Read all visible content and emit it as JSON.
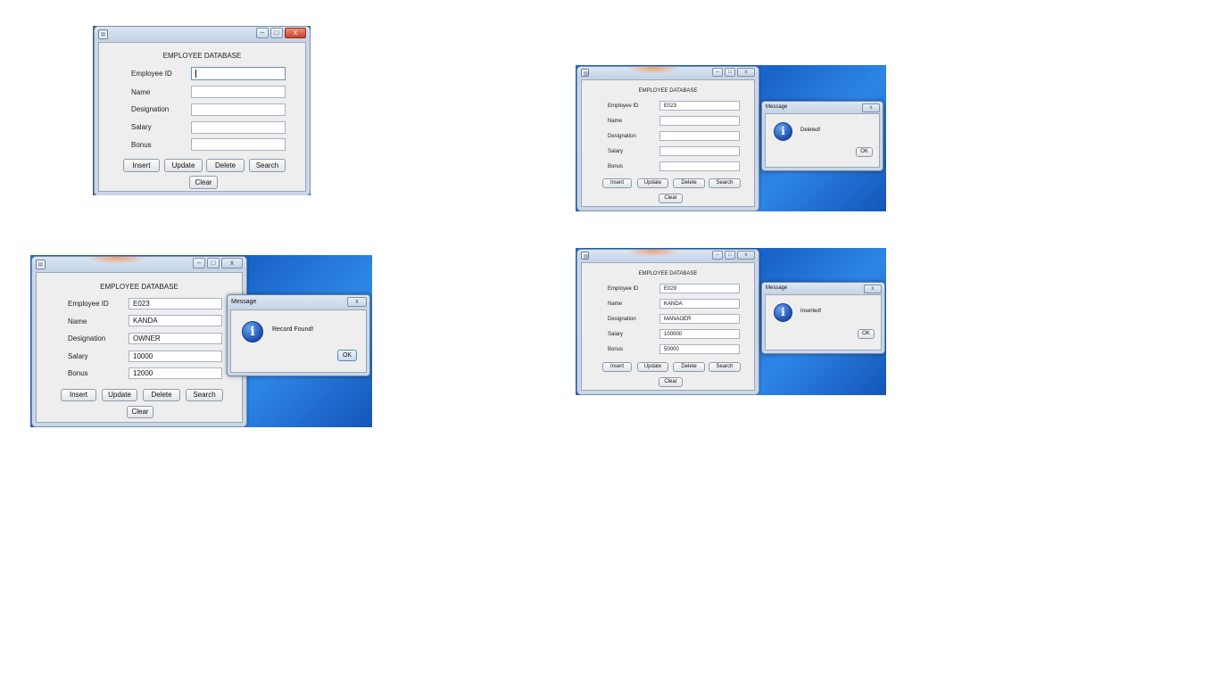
{
  "app": {
    "heading": "EMPLOYEE DATABASE",
    "labels": {
      "id": "Employee ID",
      "name": "Name",
      "designation": "Designation",
      "salary": "Salary",
      "bonus": "Bonus"
    },
    "buttons": {
      "insert": "Insert",
      "update": "Update",
      "delete": "Delete",
      "search": "Search",
      "clear": "Clear"
    },
    "caption": {
      "min": "–",
      "max": "□",
      "close": "x"
    }
  },
  "screens": {
    "empty": {
      "id": "",
      "name": "",
      "designation": "",
      "salary": "",
      "bonus": ""
    },
    "found": {
      "id": "E023",
      "name": "KANDA",
      "designation": "OWNER",
      "salary": "10000",
      "bonus": "12000"
    },
    "deleted": {
      "id": "E023",
      "name": "",
      "designation": "",
      "salary": "",
      "bonus": ""
    },
    "inserted": {
      "id": "E029",
      "name": "KANDA",
      "designation": "MANAGER",
      "salary": "100000",
      "bonus": "50000"
    }
  },
  "dialogs": {
    "title": "Message",
    "close": "x",
    "ok": "OK",
    "found_msg": "Record Found!",
    "deleted_msg": "Deleted!",
    "inserted_msg": "Inserted!"
  },
  "icons": {
    "info": "i"
  }
}
